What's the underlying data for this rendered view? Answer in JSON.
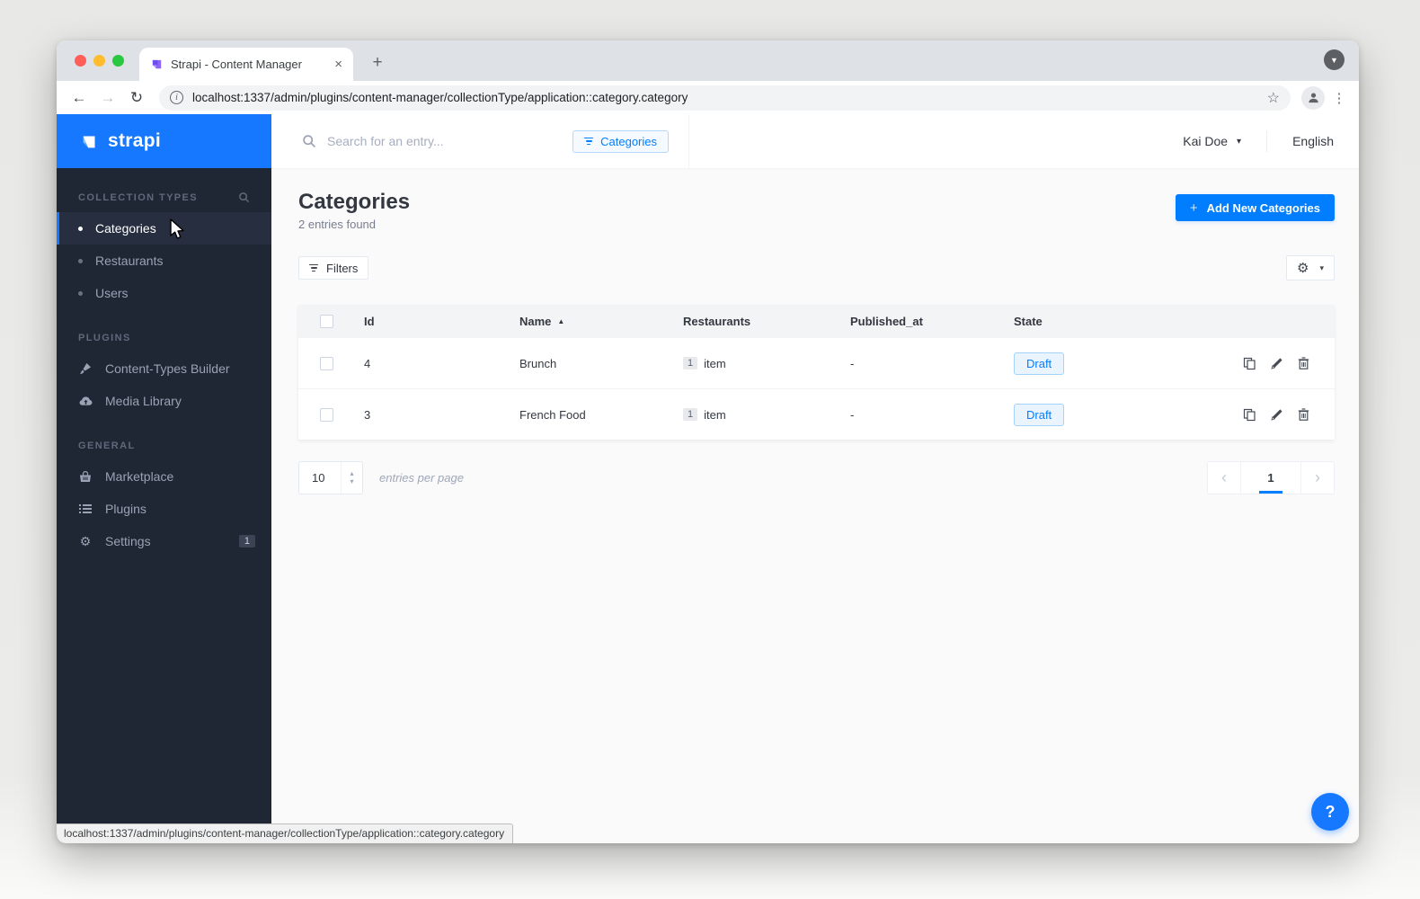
{
  "browser": {
    "tab_title": "Strapi - Content Manager",
    "url": "localhost:1337/admin/plugins/content-manager/collectionType/application::category.category",
    "status_link_preview": "localhost:1337/admin/plugins/content-manager/collectionType/application::category.category"
  },
  "icons": {
    "close": "×",
    "new_tab": "+",
    "back": "←",
    "forward": "→",
    "reload": "↻",
    "star": "☆",
    "overflow": "⋮",
    "tab_search_chevron": "▼",
    "info": "i",
    "chevron_down": "▾",
    "sort_asc": "▲",
    "stepper_up": "▴",
    "stepper_down": "▾",
    "page_prev": "‹",
    "page_next": "›",
    "gear": "⚙",
    "plus": "+",
    "help": "?"
  },
  "topbar": {
    "logo_text": "strapi",
    "search_placeholder": "Search for an entry...",
    "search_filter_chip": "Categories",
    "user_name": "Kai Doe",
    "language": "English"
  },
  "sidebar": {
    "collection_types": {
      "title": "COLLECTION TYPES",
      "items": [
        {
          "label": "Categories",
          "active": true
        },
        {
          "label": "Restaurants",
          "active": false
        },
        {
          "label": "Users",
          "active": false
        }
      ]
    },
    "plugins_section": {
      "title": "PLUGINS",
      "items": [
        {
          "label": "Content-Types Builder",
          "icon": "paint-brush-icon"
        },
        {
          "label": "Media Library",
          "icon": "cloud-upload-icon"
        }
      ]
    },
    "general_section": {
      "title": "GENERAL",
      "items": [
        {
          "label": "Marketplace",
          "icon": "shopping-basket-icon"
        },
        {
          "label": "Plugins",
          "icon": "list-icon"
        },
        {
          "label": "Settings",
          "icon": "gear-icon",
          "badge": "1"
        }
      ]
    }
  },
  "page": {
    "title": "Categories",
    "subtitle": "2 entries found",
    "add_button_label": "Add New Categories",
    "filters_button_label": "Filters"
  },
  "table": {
    "headers": [
      "Id",
      "Name",
      "Restaurants",
      "Published_at",
      "State"
    ],
    "sort_column": "Name",
    "sort_direction": "asc",
    "rows": [
      {
        "id": "4",
        "name": "Brunch",
        "restaurants_count": "1",
        "restaurants_label": "item",
        "published_at": "-",
        "state": "Draft"
      },
      {
        "id": "3",
        "name": "French Food",
        "restaurants_count": "1",
        "restaurants_label": "item",
        "published_at": "-",
        "state": "Draft"
      }
    ]
  },
  "pagination": {
    "entries_per_page_value": "10",
    "entries_per_page_label": "entries per page",
    "current_page": "1"
  },
  "colors": {
    "brand_blue": "#1678ff",
    "primary_blue": "#007eff",
    "sidebar_bg": "#1f2634",
    "draft_badge_bg": "#eaf4fe",
    "draft_badge_text": "#007eff"
  }
}
